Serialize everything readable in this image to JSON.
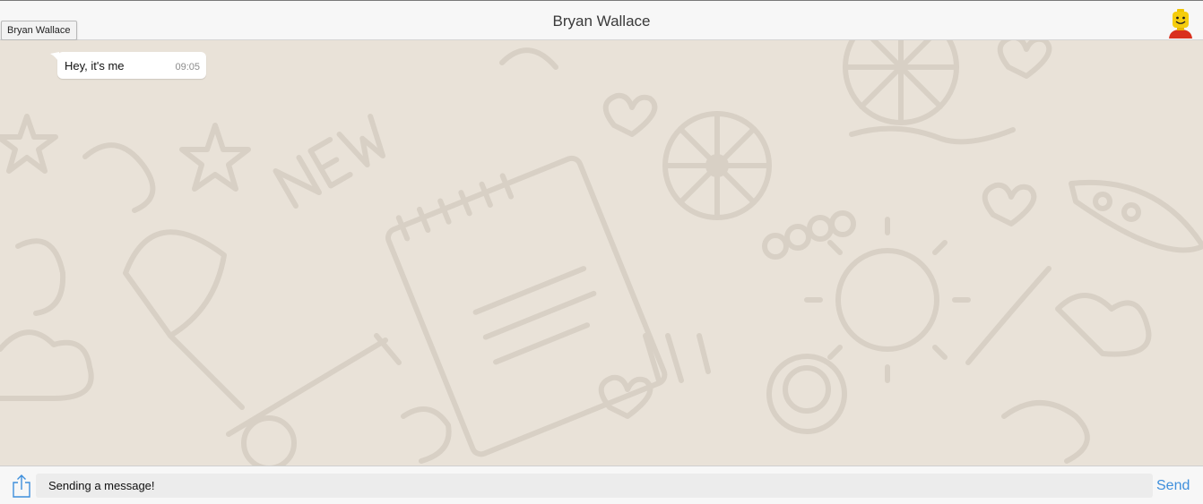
{
  "header": {
    "title": "Bryan Wallace",
    "tooltip": "Bryan Wallace",
    "avatar_icon": "lego-minifigure-avatar"
  },
  "messages": [
    {
      "text": "Hey, it's me",
      "time": "09:05",
      "direction": "incoming"
    }
  ],
  "composer": {
    "share_icon": "share-icon",
    "value": "Sending a message!",
    "send_label": "Send"
  },
  "colors": {
    "accent": "#3f8fdc",
    "wallpaper": "#e9e2d8",
    "bubble": "#ffffff"
  }
}
